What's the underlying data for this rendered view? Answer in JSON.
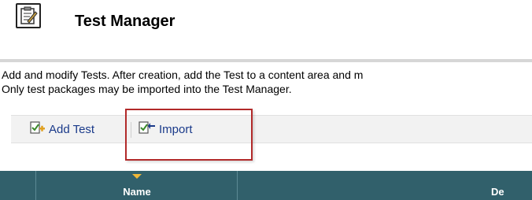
{
  "header": {
    "title": "Test Manager",
    "icon": "test-manager-clipboard-icon"
  },
  "description": {
    "line1": "Add and modify Tests. After creation, add the Test to a content area and m",
    "line2": "Only test packages may be imported into the Test Manager."
  },
  "actions": {
    "add_test_label": "Add Test",
    "add_test_icon": "add-test-icon",
    "import_label": "Import",
    "import_icon": "import-icon"
  },
  "table": {
    "columns": [
      "",
      "Name",
      "De"
    ],
    "sort_column": "Name",
    "sort_direction": "descending"
  },
  "colors": {
    "table_header_bg": "#31606b",
    "link": "#1a3a8a",
    "highlight_border": "#b22a2a",
    "sort_arrow": "#f0b838"
  }
}
